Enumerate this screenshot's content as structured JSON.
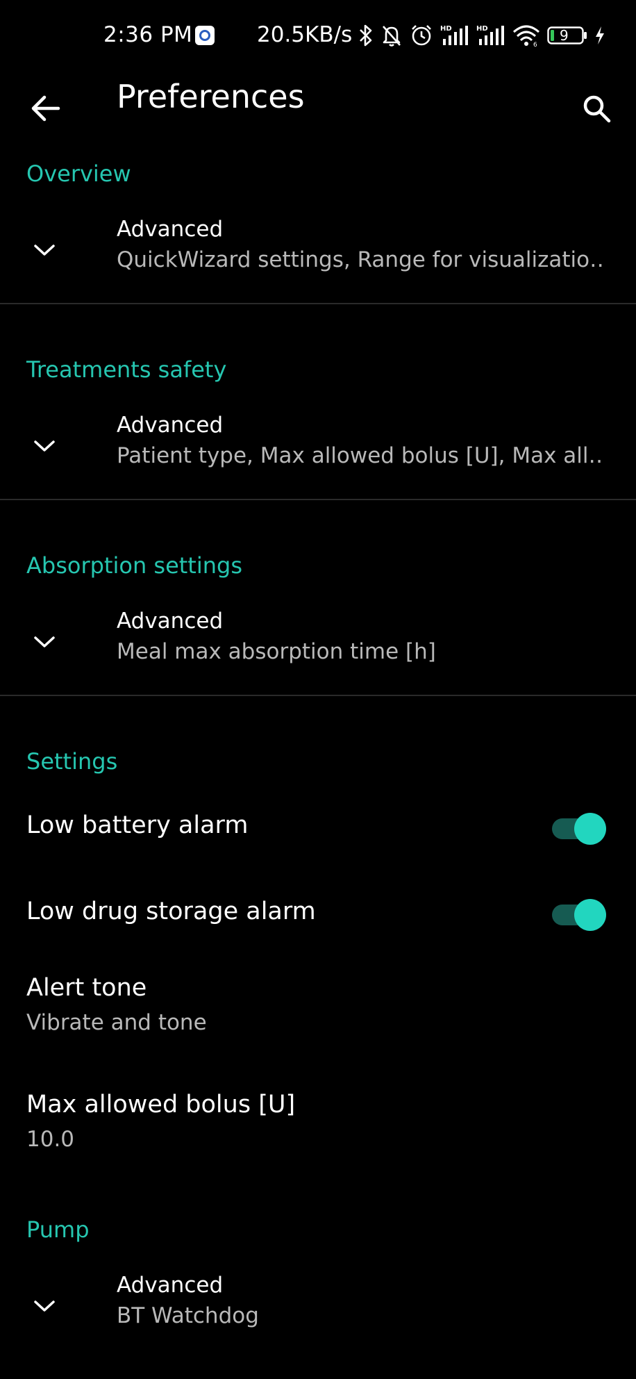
{
  "status_bar": {
    "time": "2:36 PM",
    "net_speed": "20.5KB/s",
    "battery": "9",
    "icons": [
      "bluetooth-icon",
      "bell-off-icon",
      "alarm-icon",
      "hd-signal-icon",
      "hd-signal-icon",
      "wifi-icon",
      "battery-icon",
      "charging-icon"
    ]
  },
  "app_bar": {
    "title": "Preferences",
    "back_icon": "arrow-left-icon",
    "search_icon": "search-icon"
  },
  "sections": {
    "overview": {
      "header": "Overview",
      "advanced_title": "Advanced",
      "advanced_summary": "QuickWizard settings, Range for visualizatio․․"
    },
    "treatments_safety": {
      "header": "Treatments safety",
      "advanced_title": "Advanced",
      "advanced_summary": "Patient type, Max allowed bolus [U], Max all․․"
    },
    "absorption": {
      "header": "Absorption settings",
      "advanced_title": "Advanced",
      "advanced_summary": "Meal max absorption time [h]"
    },
    "settings": {
      "header": "Settings",
      "low_battery_alarm": "Low battery alarm",
      "low_drug_storage_alarm": "Low drug storage alarm",
      "alert_tone_title": "Alert tone",
      "alert_tone_value": "Vibrate and tone",
      "max_bolus_title": "Max allowed bolus [U]",
      "max_bolus_value": "10.0"
    },
    "pump": {
      "header": "Pump",
      "advanced_title": "Advanced",
      "advanced_summary": "BT Watchdog"
    }
  },
  "toggles": {
    "low_battery_alarm": true,
    "low_drug_storage_alarm": true
  },
  "colors": {
    "accent": "#26c6b0",
    "background": "#000000",
    "switch_track": "#165b52",
    "switch_thumb": "#22d6bf"
  }
}
